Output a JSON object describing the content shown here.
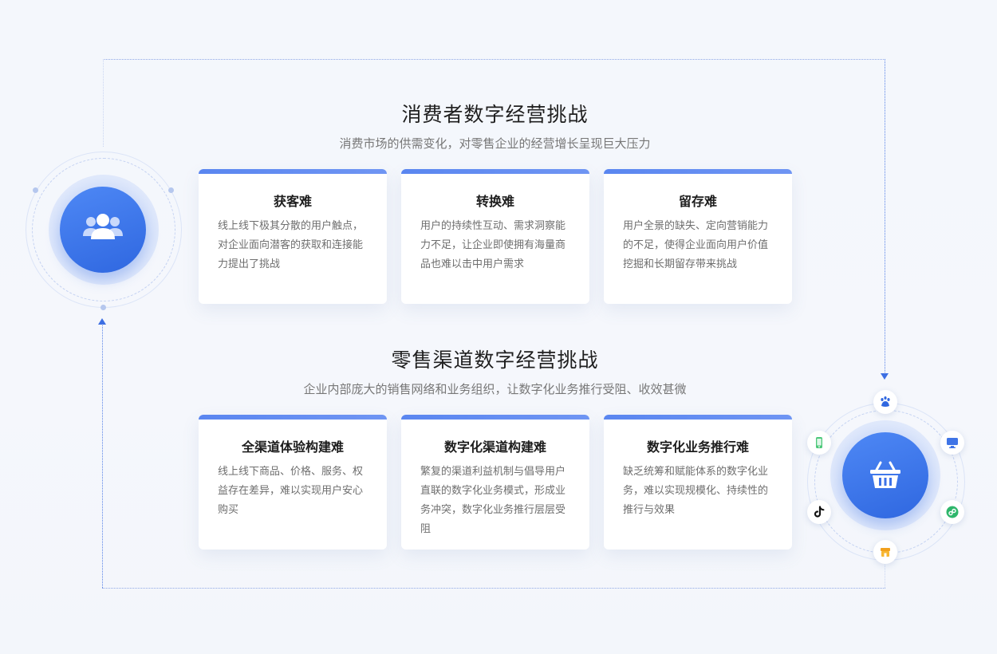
{
  "section1": {
    "title": "消费者数字经营挑战",
    "subtitle": "消费市场的供需变化，对零售企业的经营增长呈现巨大压力",
    "cards": [
      {
        "title": "获客难",
        "desc": "线上线下极其分散的用户触点，对企业面向潜客的获取和连接能力提出了挑战"
      },
      {
        "title": "转换难",
        "desc": "用户的持续性互动、需求洞察能力不足，让企业即使拥有海量商品也难以击中用户需求"
      },
      {
        "title": "留存难",
        "desc": "用户全景的缺失、定向营销能力的不足，使得企业面向用户价值挖掘和长期留存带来挑战"
      }
    ]
  },
  "section2": {
    "title": "零售渠道数字经营挑战",
    "subtitle": "企业内部庞大的销售网络和业务组织，让数字化业务推行受阻、收效甚微",
    "cards": [
      {
        "title": "全渠道体验构建难",
        "desc": "线上线下商品、价格、服务、权益存在差异，难以实现用户安心购买"
      },
      {
        "title": "数字化渠道构建难",
        "desc": "繁复的渠道利益机制与倡导用户直联的数字化业务模式，形成业务冲突，数字化业务推行层层受阻"
      },
      {
        "title": "数字化业务推行难",
        "desc": "缺乏统筹和赋能体系的数字化业务，难以实现规模化、持续性的推行与效果"
      }
    ]
  },
  "icons": {
    "left_hub": "users-icon",
    "right_hub": "shopping-basket-icon",
    "satellites": [
      "baidu-icon",
      "monitor-icon",
      "mini-program-icon",
      "store-icon",
      "tiktok-icon",
      "phone-icon"
    ]
  },
  "colors": {
    "accent": "#3d6fe3",
    "card_bar": "#5a86f0",
    "hub_gradient_start": "#4e88f5",
    "hub_gradient_end": "#2f67e0"
  }
}
